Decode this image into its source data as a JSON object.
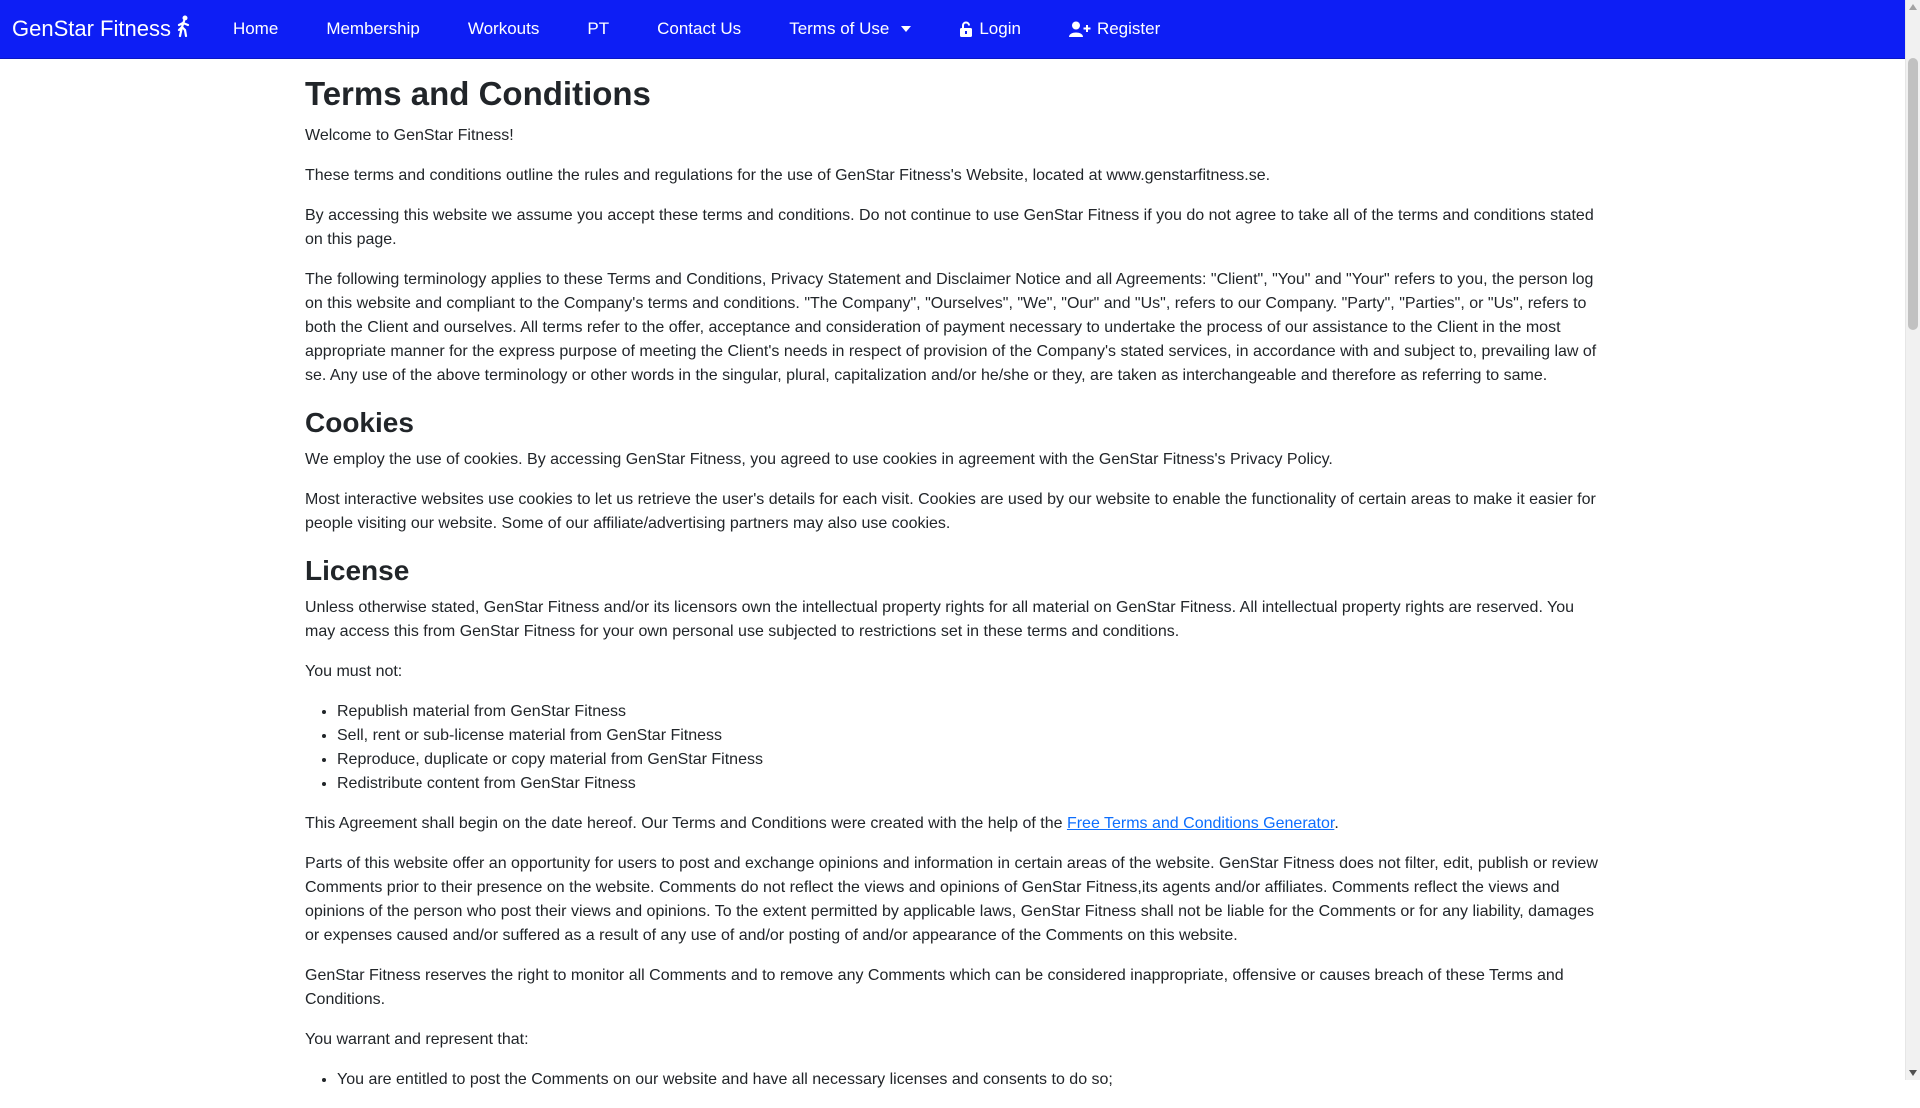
{
  "nav": {
    "brand": "GenStar Fitness",
    "items": [
      {
        "label": "Home"
      },
      {
        "label": "Membership"
      },
      {
        "label": "Workouts"
      },
      {
        "label": "PT"
      },
      {
        "label": "Contact Us"
      },
      {
        "label": "Terms of Use"
      },
      {
        "label": "Login"
      },
      {
        "label": "Register"
      }
    ],
    "color": "#0d1ef5"
  },
  "page": {
    "title": "Terms and Conditions",
    "welcome": "Welcome to GenStar Fitness!",
    "intro1": "These terms and conditions outline the rules and regulations for the use of GenStar Fitness's Website, located at www.genstarfitness.se.",
    "intro2": "By accessing this website we assume you accept these terms and conditions. Do not continue to use GenStar Fitness if you do not agree to take all of the terms and conditions stated on this page.",
    "intro3": "The following terminology applies to these Terms and Conditions, Privacy Statement and Disclaimer Notice and all Agreements: \"Client\", \"You\" and \"Your\" refers to you, the person log on this website and compliant to the Company's terms and conditions. \"The Company\", \"Ourselves\", \"We\", \"Our\" and \"Us\", refers to our Company. \"Party\", \"Parties\", or \"Us\", refers to both the Client and ourselves. All terms refer to the offer, acceptance and consideration of payment necessary to undertake the process of our assistance to the Client in the most appropriate manner for the express purpose of meeting the Client's needs in respect of provision of the Company's stated services, in accordance with and subject to, prevailing law of se. Any use of the above terminology or other words in the singular, plural, capitalization and/or he/she or they, are taken as interchangeable and therefore as referring to same.",
    "cookies": {
      "heading": "Cookies",
      "p1": "We employ the use of cookies. By accessing GenStar Fitness, you agreed to use cookies in agreement with the GenStar Fitness's Privacy Policy.",
      "p2": "Most interactive websites use cookies to let us retrieve the user's details for each visit. Cookies are used by our website to enable the functionality of certain areas to make it easier for people visiting our website. Some of our affiliate/advertising partners may also use cookies."
    },
    "license": {
      "heading": "License",
      "p1": "Unless otherwise stated, GenStar Fitness and/or its licensors own the intellectual property rights for all material on GenStar Fitness. All intellectual property rights are reserved. You may access this from GenStar Fitness for your own personal use subjected to restrictions set in these terms and conditions.",
      "must_not": "You must not:",
      "items": [
        "Republish material from GenStar Fitness",
        "Sell, rent or sub-license material from GenStar Fitness",
        "Reproduce, duplicate or copy material from GenStar Fitness",
        "Redistribute content from GenStar Fitness"
      ],
      "agreement_before": "This Agreement shall begin on the date hereof. Our Terms and Conditions were created with the help of the ",
      "agreement_link": "Free Terms and Conditions Generator",
      "agreement_after": ".",
      "p_comments": "Parts of this website offer an opportunity for users to post and exchange opinions and information in certain areas of the website. GenStar Fitness does not filter, edit, publish or review Comments prior to their presence on the website. Comments do not reflect the views and opinions of GenStar Fitness,its agents and/or affiliates. Comments reflect the views and opinions of the person who post their views and opinions. To the extent permitted by applicable laws, GenStar Fitness shall not be liable for the Comments or for any liability, damages or expenses caused and/or suffered as a result of any use of and/or posting of and/or appearance of the Comments on this website.",
      "p_reserve": "GenStar Fitness reserves the right to monitor all Comments and to remove any Comments which can be considered inappropriate, offensive or causes breach of these Terms and Conditions.",
      "warrant": "You warrant and represent that:",
      "warrant_items": [
        "You are entitled to post the Comments on our website and have all necessary licenses and consents to do so;"
      ]
    }
  }
}
